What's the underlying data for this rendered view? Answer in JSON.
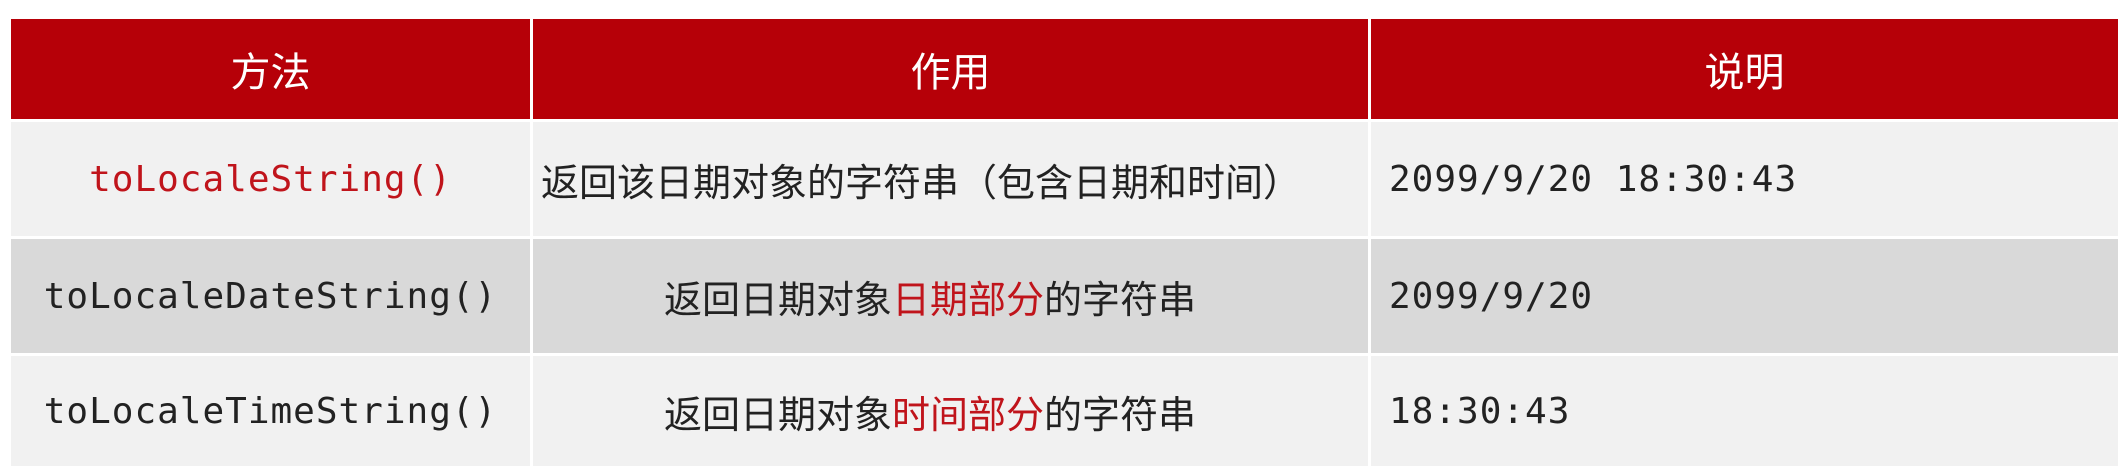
{
  "colors": {
    "header_bg": "#b60008",
    "header_text": "#ffffff",
    "row_light": "#f1f1f1",
    "row_dark": "#d9d9d9",
    "highlight_text": "#c0141b"
  },
  "header": {
    "method": "方法",
    "purpose": "作用",
    "note": "说明"
  },
  "rows": [
    {
      "method": "toLocaleString()",
      "purpose": "返回该日期对象的字符串（包含日期和时间）",
      "note": "2099/9/20 18:30:43"
    },
    {
      "method": "toLocaleDateString()",
      "purpose_pre": "返回日期对象",
      "purpose_highlight": "日期部分",
      "purpose_post": "的字符串",
      "note": "2099/9/20"
    },
    {
      "method": "toLocaleTimeString()",
      "purpose_pre": "返回日期对象",
      "purpose_highlight": "时间部分",
      "purpose_post": "的字符串",
      "note": "18:30:43"
    }
  ]
}
